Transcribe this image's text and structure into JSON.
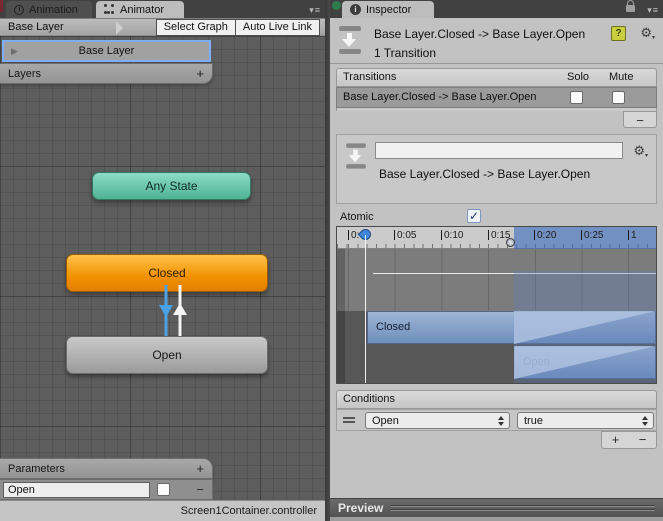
{
  "colors": {
    "selection_blue": "#7caefc",
    "node_any_state": "#5fc2a2",
    "node_closed": "#f29200",
    "node_open": "#a8a8a8",
    "transition_arrow_selected": "#4aa3e8",
    "timeline_highlight": "#3e6cbe",
    "timeline_bar": "#7d9cc6"
  },
  "animator": {
    "tabs": [
      "Animation",
      "Animator"
    ],
    "active_tab": "Animator",
    "menu_glyph": "▾≡",
    "breadcrumb": "Base Layer",
    "toolbar": {
      "select_graph": "Select Graph",
      "auto_live_link": "Auto Live Link"
    },
    "layers": {
      "selected": "Base Layer",
      "header": "Layers",
      "add": "+",
      "fold_glyph": "▶"
    },
    "graph": {
      "nodes": [
        "Any State",
        "Closed",
        "Open"
      ]
    },
    "parameters": {
      "header": "Parameters",
      "add": "+",
      "remove": "−",
      "rows": [
        {
          "name": "Open",
          "checked": false
        }
      ]
    },
    "status": "Screen1Container.controller"
  },
  "inspector": {
    "tab": "Inspector",
    "menu_glyph": "▾≡",
    "header": {
      "title": "Base Layer.Closed -> Base Layer.Open",
      "subtitle": "1 Transition",
      "help_glyph": "?",
      "gear_glyph": "⚙"
    },
    "transitions": {
      "title": "Transitions",
      "solo": "Solo",
      "mute": "Mute",
      "remove": "−",
      "rows": [
        {
          "label": "Base Layer.Closed -> Base Layer.Open",
          "solo": false,
          "mute": false
        }
      ]
    },
    "detail": {
      "name": "",
      "label": "Base Layer.Closed -> Base Layer.Open",
      "gear_glyph": "⚙"
    },
    "atomic": {
      "label": "Atomic",
      "checked": true,
      "check_glyph": "✓"
    },
    "timeline": {
      "ruler": [
        "0:00",
        "0:05",
        "0:10",
        "0:15",
        "0:20",
        "0:25",
        "1"
      ],
      "tracks": [
        "Closed",
        "Open"
      ],
      "playhead_time": "0:00",
      "transition_start": "0:15"
    },
    "conditions": {
      "title": "Conditions",
      "add": "+",
      "remove": "−",
      "rows": [
        {
          "parameter": "Open",
          "value": "true"
        }
      ]
    },
    "preview": {
      "label": "Preview"
    }
  }
}
